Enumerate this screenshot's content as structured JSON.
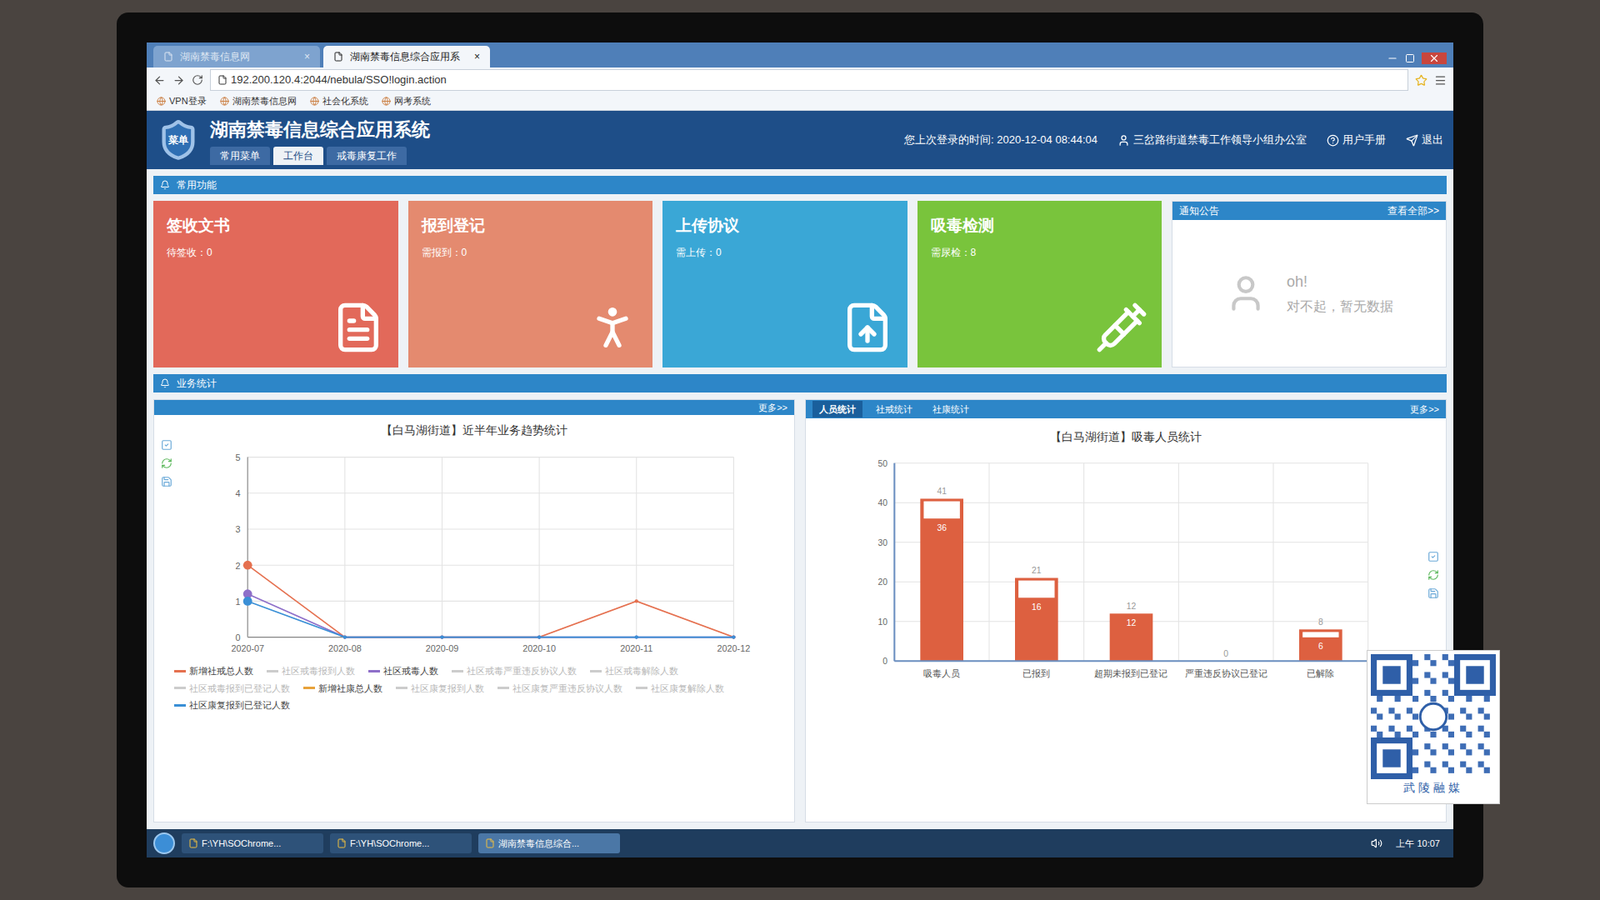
{
  "browser": {
    "tabs": [
      {
        "label": "湖南禁毒信息网",
        "selected": false,
        "close": "×"
      },
      {
        "label": "湖南禁毒信息综合应用系",
        "selected": true,
        "close": "×"
      }
    ],
    "address": "192.200.120.4:2044/nebula/SSO!login.action",
    "bookmarks": [
      "VPN登录",
      "湖南禁毒信息网",
      "社会化系统",
      "网考系统"
    ]
  },
  "app": {
    "logo": "菜单",
    "title": "湖南禁毒信息综合应用系统",
    "nav_tabs": [
      {
        "label": "常用菜单",
        "selected": false
      },
      {
        "label": "工作台",
        "selected": true
      },
      {
        "label": "戒毒康复工作",
        "selected": false
      }
    ],
    "last_login": "您上次登录的时间: 2020-12-04 08:44:04",
    "user": "三岔路街道禁毒工作领导小组办公室",
    "manual": "用户手册",
    "logout": "退出"
  },
  "common_section": "常用功能",
  "cards": [
    {
      "title": "签收文书",
      "sub": "待签收：0",
      "color": "#e2695a",
      "kind": "sign"
    },
    {
      "title": "报到登记",
      "sub": "需报到：0",
      "color": "#e48a6f",
      "kind": "person"
    },
    {
      "title": "上传协议",
      "sub": "需上传：0",
      "color": "#3aa7d6",
      "kind": "upload"
    },
    {
      "title": "吸毒检测",
      "sub": "需尿检：8",
      "color": "#79c43c",
      "kind": "test"
    }
  ],
  "notice": {
    "title": "通知公告",
    "more": "查看全部>>",
    "oh": "oh!",
    "empty": "对不起，暂无数据"
  },
  "stats_section": "业务统计",
  "line_chart": {
    "title": "【白马湖街道】近半年业务趋势统计",
    "more": "更多>>",
    "y_ticks": [
      "0",
      "1",
      "2",
      "3",
      "4",
      "5"
    ],
    "x_ticks": [
      "2020-07",
      "2020-08",
      "2020-09",
      "2020-10",
      "2020-11",
      "2020-12"
    ],
    "series": [
      {
        "name": "新增社戒总人数",
        "color": "#e5704f",
        "active": true,
        "values": [
          2,
          0,
          0,
          0,
          1,
          0
        ]
      },
      {
        "name": "社区戒毒报到人数",
        "color": "#c9c9c9",
        "active": false,
        "values": []
      },
      {
        "name": "社区戒毒人数",
        "color": "#8e6fc9",
        "active": true,
        "values": [
          1.2,
          0,
          0,
          0,
          0,
          0
        ]
      },
      {
        "name": "社区戒毒严重违反协议人数",
        "color": "#c9c9c9",
        "active": false,
        "values": []
      },
      {
        "name": "社区戒毒解除人数",
        "color": "#c9c9c9",
        "active": false,
        "values": []
      },
      {
        "name": "社区戒毒报到已登记人数",
        "color": "#c9c9c9",
        "active": false,
        "values": []
      },
      {
        "name": "新增社康总人数",
        "color": "#e8a23a",
        "active": true,
        "values": []
      },
      {
        "name": "社区康复报到人数",
        "color": "#c9c9c9",
        "active": false,
        "values": []
      },
      {
        "name": "社区康复严重违反协议人数",
        "color": "#c9c9c9",
        "active": false,
        "values": []
      },
      {
        "name": "社区康复解除人数",
        "color": "#c9c9c9",
        "active": false,
        "values": []
      },
      {
        "name": "社区康复报到已登记人数",
        "color": "#3a8fd6",
        "active": true,
        "values": [
          1,
          0,
          0,
          0,
          0,
          0
        ]
      }
    ]
  },
  "bar_panel": {
    "tabs": [
      {
        "label": "人员统计",
        "selected": true
      },
      {
        "label": "社戒统计",
        "selected": false
      },
      {
        "label": "社康统计",
        "selected": false
      }
    ],
    "more": "更多>>",
    "title": "【白马湖街道】吸毒人员统计",
    "y_ticks": [
      "0",
      "10",
      "20",
      "30",
      "40",
      "50"
    ],
    "bars": [
      {
        "label": "吸毒人员",
        "total": 41,
        "total_text": "41",
        "inner": 36,
        "inner_text": "36"
      },
      {
        "label": "已报到",
        "total": 21,
        "total_text": "21",
        "inner": 16,
        "inner_text": "16"
      },
      {
        "label": "超期未报到已登记",
        "total": 12,
        "total_text": "12",
        "inner": 12,
        "inner_text": "12"
      },
      {
        "label": "严重违反协议已登记",
        "total": 0,
        "total_text": "0",
        "inner": 0,
        "inner_text": ""
      },
      {
        "label": "已解除",
        "total": 8,
        "total_text": "8",
        "inner": 6,
        "inner_text": "6"
      }
    ]
  },
  "taskbar": {
    "items": [
      {
        "label": "F:\\YH\\SOChrome...",
        "selected": false
      },
      {
        "label": "F:\\YH\\SOChrome...",
        "selected": false
      },
      {
        "label": "湖南禁毒信息综合...",
        "selected": true
      }
    ],
    "time": "上午 10:07"
  },
  "watermark": "武陵融媒"
}
